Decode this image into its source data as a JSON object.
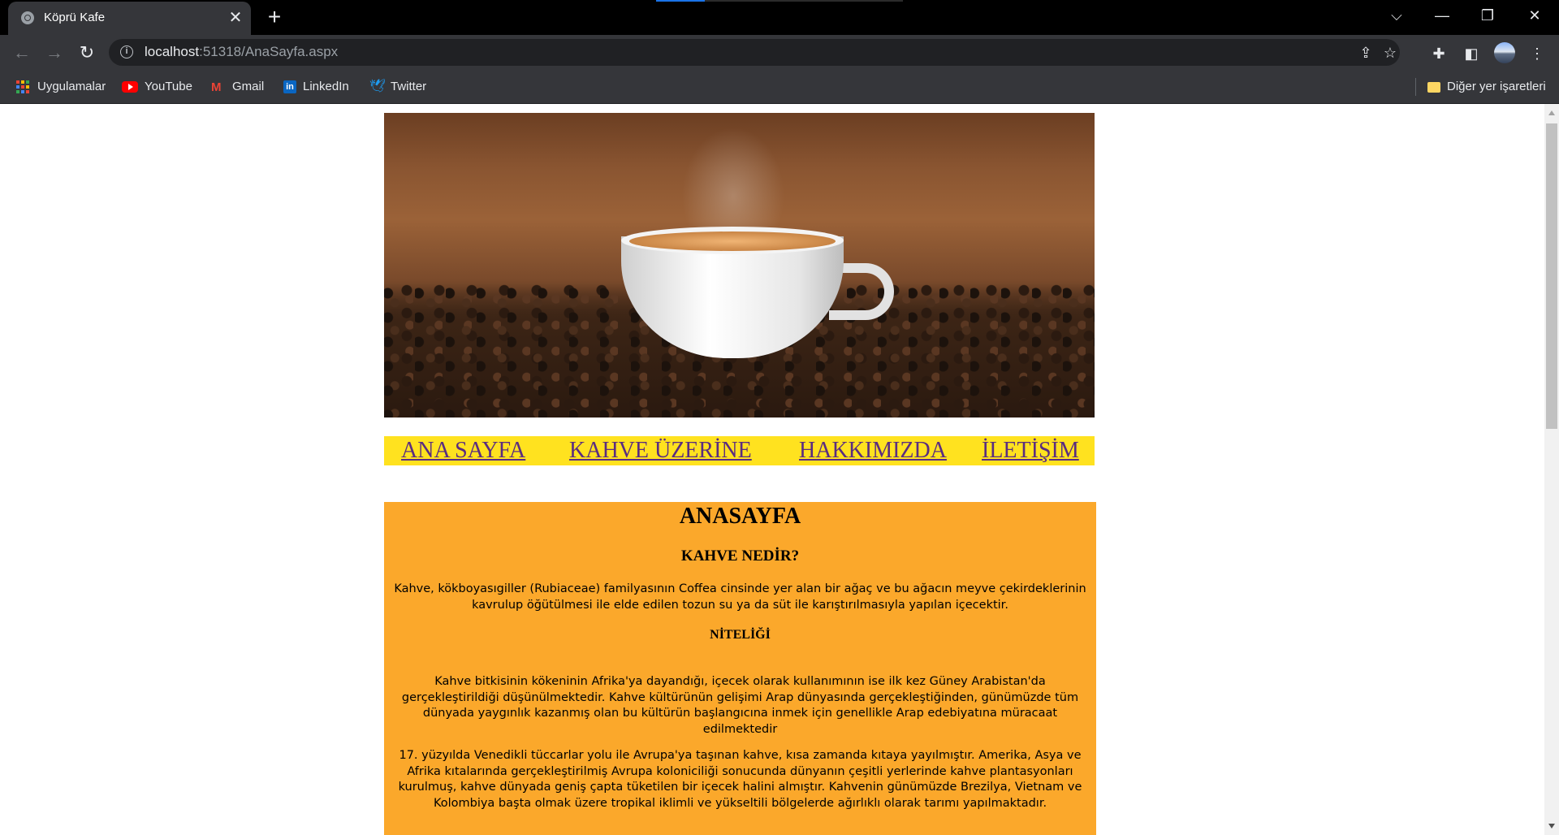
{
  "browser": {
    "tab_title": "Köprü Kafe",
    "url_host": "localhost",
    "url_rest": ":51318/AnaSayfa.aspx",
    "bookmarks": [
      "Uygulamalar",
      "YouTube",
      "Gmail",
      "LinkedIn",
      "Twitter"
    ],
    "other_bookmarks": "Diğer yer işaretleri"
  },
  "nav": {
    "links": [
      "ANA SAYFA",
      "KAHVE ÜZERİNE",
      "HAKKIMIZDA",
      "İLETİŞİM"
    ]
  },
  "content": {
    "title": "ANASAYFA",
    "h_what": "KAHVE NEDİR?",
    "p_what": "Kahve, kökboyasıgiller (Rubiaceae) familyasının Coffea cinsinde yer alan bir ağaç ve bu ağacın meyve çekirdeklerinin kavrulup öğütülmesi ile elde edilen tozun su ya da süt ile karıştırılmasıyla yapılan içecektir.",
    "h_quality": "NİTELİĞİ",
    "p_quality_1": "Kahve bitkisinin kökeninin Afrika'ya dayandığı, içecek olarak kullanımının ise ilk kez Güney Arabistan'da gerçekleştirildiği düşünülmektedir. Kahve kültürünün gelişimi Arap dünyasında gerçekleştiğinden, günümüzde tüm dünyada yaygınlık kazanmış olan bu kültürün başlangıcına inmek için genellikle Arap edebiyatına müracaat edilmektedir",
    "p_quality_2": "17. yüzyılda Venedikli tüccarlar yolu ile Avrupa'ya taşınan kahve, kısa zamanda kıtaya yayılmıştır. Amerika, Asya ve Afrika kıtalarında gerçekleştirilmiş Avrupa koloniciliği sonucunda dünyanın çeşitli yerlerinde kahve plantasyonları kurulmuş, kahve dünyada geniş çapta tüketilen bir içecek halini almıştır. Kahvenin günümüzde Brezilya, Vietnam ve Kolombiya başta olmak üzere tropikal iklimli ve yükseltili bölgelerde ağırlıklı olarak tarımı yapılmaktadır."
  },
  "colors": {
    "nav_bg": "#ffe21f",
    "content_bg": "#fba82b",
    "link": "#5a2d80"
  }
}
